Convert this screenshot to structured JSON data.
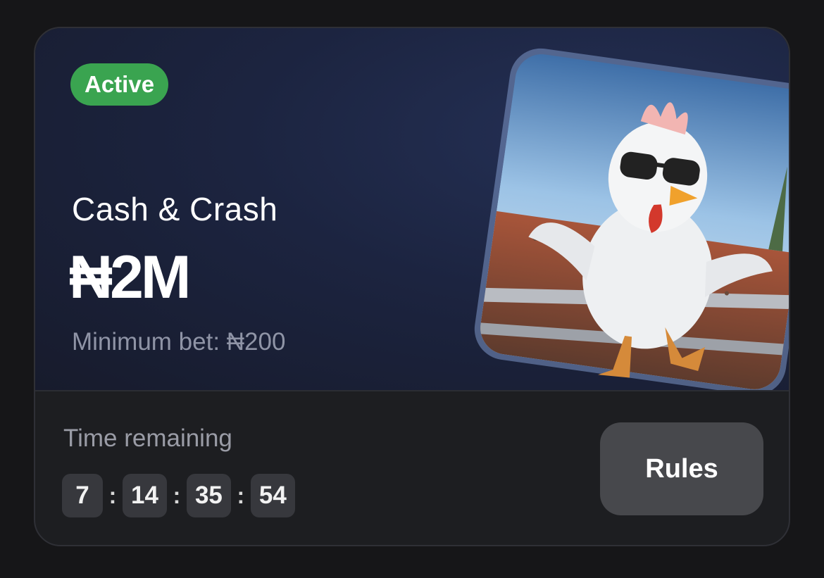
{
  "promo": {
    "status_badge": "Active",
    "game_title": "Cash & Crash",
    "prize_amount": "₦2M",
    "minimum_bet": "Minimum bet: ₦200",
    "image_subject": "chicken-with-sunglasses-illustration"
  },
  "countdown": {
    "label": "Time remaining",
    "days": "7",
    "hours": "14",
    "minutes": "35",
    "seconds": "54"
  },
  "actions": {
    "rules_label": "Rules"
  },
  "colors": {
    "badge_active": "#3aa450",
    "card_background": "#1d1e21",
    "hero_background": "#1c2440",
    "button_background": "#47484c"
  }
}
